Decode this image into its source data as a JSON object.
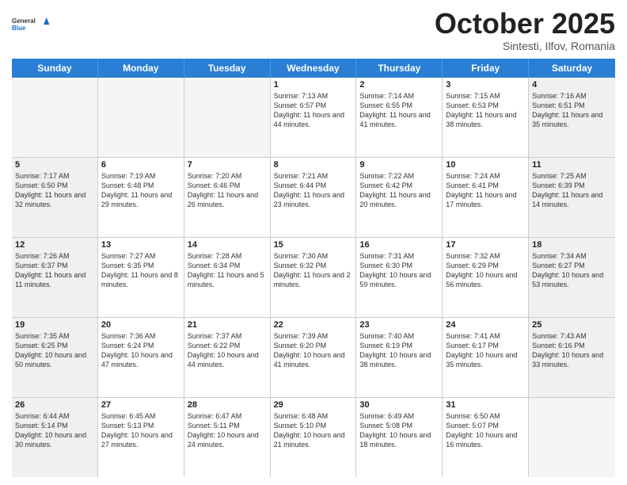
{
  "logo": {
    "general": "General",
    "blue": "Blue"
  },
  "header": {
    "month": "October 2025",
    "location": "Sintesti, Ilfov, Romania"
  },
  "days": [
    "Sunday",
    "Monday",
    "Tuesday",
    "Wednesday",
    "Thursday",
    "Friday",
    "Saturday"
  ],
  "weeks": [
    [
      {
        "day": "",
        "info": "",
        "empty": true
      },
      {
        "day": "",
        "info": "",
        "empty": true
      },
      {
        "day": "",
        "info": "",
        "empty": true
      },
      {
        "day": "1",
        "info": "Sunrise: 7:13 AM\nSunset: 6:57 PM\nDaylight: 11 hours and 44 minutes."
      },
      {
        "day": "2",
        "info": "Sunrise: 7:14 AM\nSunset: 6:55 PM\nDaylight: 11 hours and 41 minutes."
      },
      {
        "day": "3",
        "info": "Sunrise: 7:15 AM\nSunset: 6:53 PM\nDaylight: 11 hours and 38 minutes."
      },
      {
        "day": "4",
        "info": "Sunrise: 7:16 AM\nSunset: 6:51 PM\nDaylight: 11 hours and 35 minutes.",
        "shaded": true
      }
    ],
    [
      {
        "day": "5",
        "info": "Sunrise: 7:17 AM\nSunset: 6:50 PM\nDaylight: 11 hours and 32 minutes.",
        "shaded": true
      },
      {
        "day": "6",
        "info": "Sunrise: 7:19 AM\nSunset: 6:48 PM\nDaylight: 11 hours and 29 minutes."
      },
      {
        "day": "7",
        "info": "Sunrise: 7:20 AM\nSunset: 6:46 PM\nDaylight: 11 hours and 26 minutes."
      },
      {
        "day": "8",
        "info": "Sunrise: 7:21 AM\nSunset: 6:44 PM\nDaylight: 11 hours and 23 minutes."
      },
      {
        "day": "9",
        "info": "Sunrise: 7:22 AM\nSunset: 6:42 PM\nDaylight: 11 hours and 20 minutes."
      },
      {
        "day": "10",
        "info": "Sunrise: 7:24 AM\nSunset: 6:41 PM\nDaylight: 11 hours and 17 minutes."
      },
      {
        "day": "11",
        "info": "Sunrise: 7:25 AM\nSunset: 6:39 PM\nDaylight: 11 hours and 14 minutes.",
        "shaded": true
      }
    ],
    [
      {
        "day": "12",
        "info": "Sunrise: 7:26 AM\nSunset: 6:37 PM\nDaylight: 11 hours and 11 minutes.",
        "shaded": true
      },
      {
        "day": "13",
        "info": "Sunrise: 7:27 AM\nSunset: 6:35 PM\nDaylight: 11 hours and 8 minutes."
      },
      {
        "day": "14",
        "info": "Sunrise: 7:28 AM\nSunset: 6:34 PM\nDaylight: 11 hours and 5 minutes."
      },
      {
        "day": "15",
        "info": "Sunrise: 7:30 AM\nSunset: 6:32 PM\nDaylight: 11 hours and 2 minutes."
      },
      {
        "day": "16",
        "info": "Sunrise: 7:31 AM\nSunset: 6:30 PM\nDaylight: 10 hours and 59 minutes."
      },
      {
        "day": "17",
        "info": "Sunrise: 7:32 AM\nSunset: 6:29 PM\nDaylight: 10 hours and 56 minutes."
      },
      {
        "day": "18",
        "info": "Sunrise: 7:34 AM\nSunset: 6:27 PM\nDaylight: 10 hours and 53 minutes.",
        "shaded": true
      }
    ],
    [
      {
        "day": "19",
        "info": "Sunrise: 7:35 AM\nSunset: 6:25 PM\nDaylight: 10 hours and 50 minutes.",
        "shaded": true
      },
      {
        "day": "20",
        "info": "Sunrise: 7:36 AM\nSunset: 6:24 PM\nDaylight: 10 hours and 47 minutes."
      },
      {
        "day": "21",
        "info": "Sunrise: 7:37 AM\nSunset: 6:22 PM\nDaylight: 10 hours and 44 minutes."
      },
      {
        "day": "22",
        "info": "Sunrise: 7:39 AM\nSunset: 6:20 PM\nDaylight: 10 hours and 41 minutes."
      },
      {
        "day": "23",
        "info": "Sunrise: 7:40 AM\nSunset: 6:19 PM\nDaylight: 10 hours and 38 minutes."
      },
      {
        "day": "24",
        "info": "Sunrise: 7:41 AM\nSunset: 6:17 PM\nDaylight: 10 hours and 35 minutes."
      },
      {
        "day": "25",
        "info": "Sunrise: 7:43 AM\nSunset: 6:16 PM\nDaylight: 10 hours and 33 minutes.",
        "shaded": true
      }
    ],
    [
      {
        "day": "26",
        "info": "Sunrise: 6:44 AM\nSunset: 5:14 PM\nDaylight: 10 hours and 30 minutes.",
        "shaded": true
      },
      {
        "day": "27",
        "info": "Sunrise: 6:45 AM\nSunset: 5:13 PM\nDaylight: 10 hours and 27 minutes."
      },
      {
        "day": "28",
        "info": "Sunrise: 6:47 AM\nSunset: 5:11 PM\nDaylight: 10 hours and 24 minutes."
      },
      {
        "day": "29",
        "info": "Sunrise: 6:48 AM\nSunset: 5:10 PM\nDaylight: 10 hours and 21 minutes."
      },
      {
        "day": "30",
        "info": "Sunrise: 6:49 AM\nSunset: 5:08 PM\nDaylight: 10 hours and 18 minutes."
      },
      {
        "day": "31",
        "info": "Sunrise: 6:50 AM\nSunset: 5:07 PM\nDaylight: 10 hours and 16 minutes."
      },
      {
        "day": "",
        "info": "",
        "empty": true
      }
    ]
  ]
}
